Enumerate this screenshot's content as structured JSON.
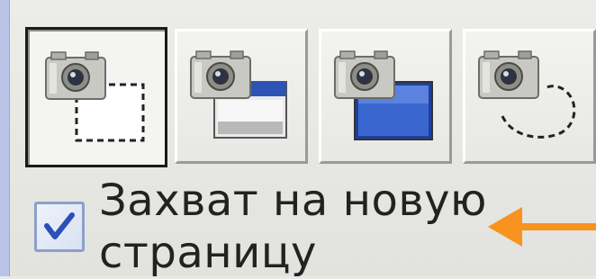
{
  "toolbar": {
    "buttons": [
      {
        "name": "capture-region-button",
        "icon": "camera-dashed-rectangle-icon",
        "selected": true
      },
      {
        "name": "capture-window-button",
        "icon": "camera-window-icon",
        "selected": false
      },
      {
        "name": "capture-fullscreen-button",
        "icon": "camera-fullscreen-icon",
        "selected": false
      },
      {
        "name": "capture-freehand-button",
        "icon": "camera-freehand-icon",
        "selected": false
      }
    ]
  },
  "option": {
    "checked": true,
    "label": "Захват на новую страницу"
  },
  "colors": {
    "arrow": "#f7931e",
    "check": "#2c4fb8",
    "selected_border": "#1a1a1a",
    "background": "#e9e9e6"
  },
  "annotation": {
    "icon": "arrow-left-icon"
  }
}
